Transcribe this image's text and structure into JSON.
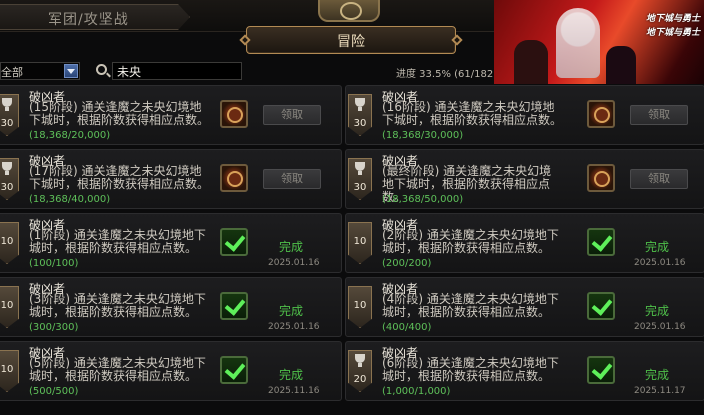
{
  "tabs": {
    "legion": "军团/攻坚战",
    "adventure": "冒险"
  },
  "filter": {
    "category": "全部",
    "search_value": "未央"
  },
  "progress_text": "进度 33.5% (61/182)",
  "ad": {
    "logo_line1": "地下城与勇士",
    "logo_line2": "地下城与勇士"
  },
  "left_cards": [
    {
      "title": "破凶者",
      "desc": "(15阶段) 通关逢魔之未央幻境地下城时，根据阶数获得相应点数。",
      "progress": "(18,368/20,000)",
      "points": "30",
      "trophy": true,
      "state": "claim",
      "action": "领取",
      "date": ""
    },
    {
      "title": "破凶者",
      "desc": "(17阶段) 通关逢魔之未央幻境地下城时，根据阶数获得相应点数。",
      "progress": "(18,368/40,000)",
      "points": "30",
      "trophy": true,
      "state": "claim",
      "action": "领取",
      "date": ""
    },
    {
      "title": "破凶者",
      "desc": "(1阶段) 通关逢魔之未央幻境地下城时，根据阶数获得相应点数。",
      "progress": "(100/100)",
      "points": "10",
      "trophy": false,
      "state": "done",
      "action": "完成",
      "date": "2025.01.16"
    },
    {
      "title": "破凶者",
      "desc": "(3阶段) 通关逢魔之未央幻境地下城时，根据阶数获得相应点数。",
      "progress": "(300/300)",
      "points": "10",
      "trophy": false,
      "state": "done",
      "action": "完成",
      "date": "2025.01.16"
    },
    {
      "title": "破凶者",
      "desc": "(5阶段) 通关逢魔之未央幻境地下城时，根据阶数获得相应点数。",
      "progress": "(500/500)",
      "points": "10",
      "trophy": false,
      "state": "done",
      "action": "完成",
      "date": "2025.11.16"
    }
  ],
  "right_cards": [
    {
      "title": "破凶者",
      "desc": "(16阶段) 通关逢魔之未央幻境地下城时，根据阶数获得相应点数。",
      "progress": "(18,368/30,000)",
      "points": "30",
      "trophy": true,
      "state": "claim",
      "action": "领取",
      "date": ""
    },
    {
      "title": "破凶者",
      "desc": "(最终阶段) 通关逢魔之未央幻境地下城时，根据阶数获得相应点数。",
      "progress": "(18,368/50,000)",
      "points": "30",
      "trophy": true,
      "state": "claim",
      "action": "领取",
      "date": ""
    },
    {
      "title": "破凶者",
      "desc": "(2阶段) 通关逢魔之未央幻境地下城时，根据阶数获得相应点数。",
      "progress": "(200/200)",
      "points": "10",
      "trophy": false,
      "state": "done",
      "action": "完成",
      "date": "2025.01.16"
    },
    {
      "title": "破凶者",
      "desc": "(4阶段) 通关逢魔之未央幻境地下城时，根据阶数获得相应点数。",
      "progress": "(400/400)",
      "points": "10",
      "trophy": false,
      "state": "done",
      "action": "完成",
      "date": "2025.01.16"
    },
    {
      "title": "破凶者",
      "desc": "(6阶段) 通关逢魔之未央幻境地下城时，根据阶数获得相应点数。",
      "progress": "(1,000/1,000)",
      "points": "20",
      "trophy": true,
      "state": "done",
      "action": "完成",
      "date": "2025.11.17"
    }
  ]
}
